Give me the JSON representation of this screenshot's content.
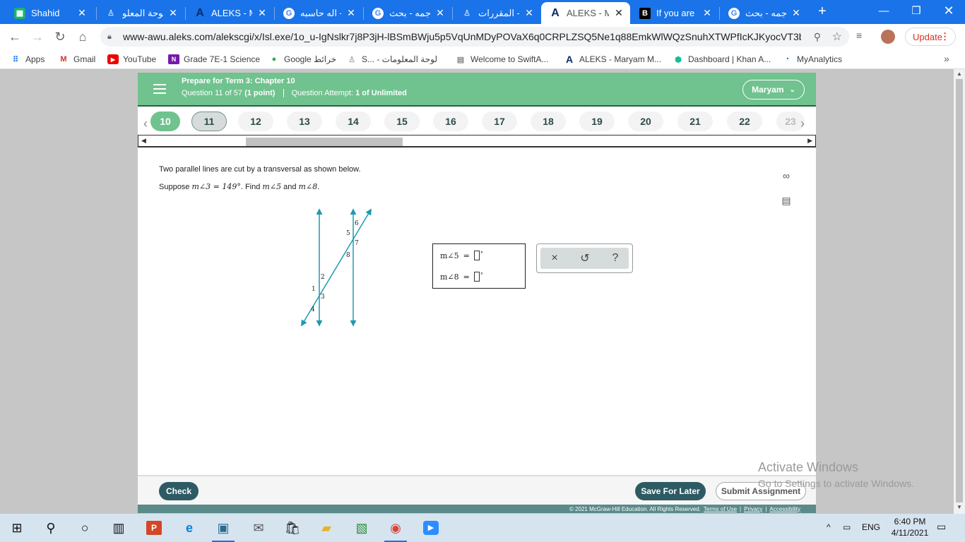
{
  "browser": {
    "tabs": [
      {
        "title": "Shahid",
        "icon": "shahid-icon",
        "color": "#19b46e"
      },
      {
        "title": "لوحة المعلو",
        "icon": "person-icon",
        "color": "#888888"
      },
      {
        "title": "ALEKS - Ma",
        "icon": "aleks-icon",
        "color": "#1a3b8f"
      },
      {
        "title": "اله حاسبه -",
        "icon": "google-icon",
        "color": "#4285f4"
      },
      {
        "title": "ترجمه - بحث",
        "icon": "google-icon",
        "color": "#4285f4"
      },
      {
        "title": "المقررات - y",
        "icon": "person-icon",
        "color": "#888888"
      },
      {
        "title": "ALEKS - Ma",
        "icon": "aleks-icon",
        "color": "#1a3b8f"
      },
      {
        "title": "If you are s",
        "icon": "b-icon",
        "color": "#000000"
      },
      {
        "title": "ترجمه - بحث",
        "icon": "google-icon",
        "color": "#4285f4"
      }
    ],
    "active_tab_index": 6,
    "url": "www-awu.aleks.com/alekscgi/x/Isl.exe/1o_u-IgNslkr7j8P3jH-lBSmBWju5p5VqUnMDyPOVaX6q0CRPLZSQ5Ne1q88EmkWlWQzSnuhXTWPfIcKJKyocVT3bAJ...",
    "update_label": "Update",
    "bookmarks": [
      {
        "label": "Apps",
        "icon": "apps-grid-icon"
      },
      {
        "label": "Gmail",
        "icon": "gmail-icon"
      },
      {
        "label": "YouTube",
        "icon": "youtube-icon"
      },
      {
        "label": "Grade 7E-1 Science",
        "icon": "onenote-icon"
      },
      {
        "label": "Google خرائط",
        "icon": "maps-pin-icon"
      },
      {
        "label": "S... - لوحة المعلومات",
        "icon": "person-icon"
      },
      {
        "label": "Welcome to SwiftA...",
        "icon": "page-icon"
      },
      {
        "label": "ALEKS - Maryam M...",
        "icon": "aleks-icon"
      },
      {
        "label": "Dashboard | Khan A...",
        "icon": "khan-icon"
      },
      {
        "label": "MyAnalytics",
        "icon": "analytics-icon"
      }
    ]
  },
  "aleks": {
    "header": {
      "title": "Prepare for Term 3: Chapter 10",
      "question_label": "Question 11 of 57",
      "points_label": "(1 point)",
      "attempt_prefix": "Question Attempt:",
      "attempt_value": "1 of Unlimited",
      "user": "Maryam"
    },
    "question_nav": [
      "10",
      "11",
      "12",
      "13",
      "14",
      "15",
      "16",
      "17",
      "18",
      "19",
      "20",
      "21",
      "22",
      "23"
    ],
    "current_question": "11",
    "question": {
      "line1": "Two parallel lines are cut by a transversal as shown below.",
      "line2_prefix": "Suppose ",
      "given": "m∠3 = 149°",
      "find_prefix": ". Find ",
      "find_a": "m∠5",
      "and": " and ",
      "find_b": "m∠8",
      "end": "."
    },
    "figure_labels": [
      "1",
      "2",
      "3",
      "4",
      "5",
      "6",
      "7",
      "8"
    ],
    "answers": [
      {
        "label": "m∠5",
        "eq": "=",
        "value": "",
        "unit": "°"
      },
      {
        "label": "m∠8",
        "eq": "=",
        "value": "",
        "unit": "°"
      }
    ],
    "tools": {
      "clear": "×",
      "undo": "↺",
      "help": "?"
    },
    "footer": {
      "check": "Check",
      "save": "Save For Later",
      "submit": "Submit Assignment",
      "copyright": "© 2021 McGraw-Hill Education. All Rights Reserved.",
      "terms": "Terms of Use",
      "privacy": "Privacy",
      "accessibility": "Accessibility"
    }
  },
  "watermark": {
    "line1": "Activate Windows",
    "line2": "Go to Settings to activate Windows."
  },
  "taskbar": {
    "language": "ENG",
    "time": "6:40 PM",
    "date": "4/11/2021"
  },
  "colors": {
    "aleks_green": "#70c28e",
    "aleks_dark": "#2e5b63",
    "chrome_blue": "#1a73e8",
    "figure_line": "#1b9bb0"
  }
}
